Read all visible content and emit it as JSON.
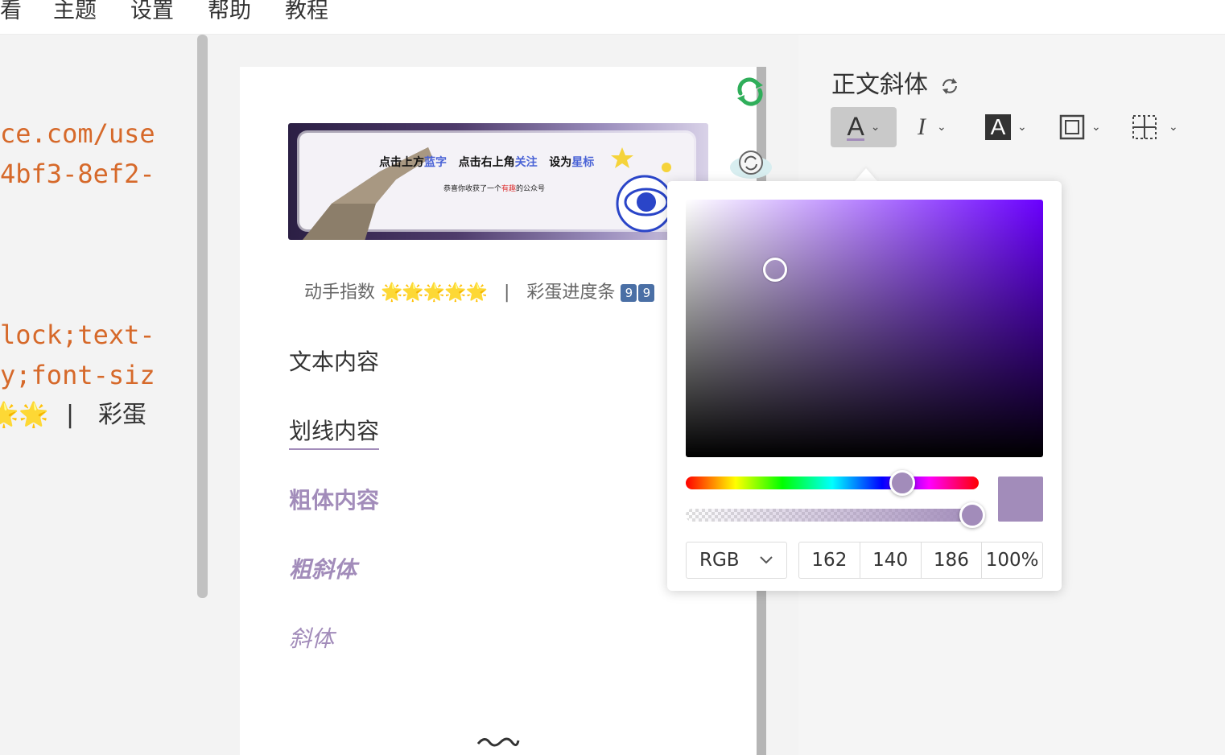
{
  "menubar": {
    "items": [
      "看",
      "主题",
      "设置",
      "帮助",
      "教程"
    ]
  },
  "editor": {
    "lines": [
      "ce.com/use",
      "4bf3-8ef2-",
      "lock;text-",
      "y;font-siz"
    ],
    "last_line_stars": "🌟🌟",
    "last_line_sep": "|",
    "last_line_text": "彩蛋"
  },
  "banner": {
    "part1": "点击上方",
    "part1_blue": "蓝字",
    "part2": "点击右上角",
    "part2_blue": "关注",
    "part3": "设为",
    "part3_blue": "星标",
    "sub_pre": "恭喜你收获了一个",
    "sub_red": "有趣",
    "sub_post": "的公众号"
  },
  "info": {
    "label1": "动手指数",
    "stars": "🌟🌟🌟🌟🌟",
    "sep": "|",
    "label2": "彩蛋进度条",
    "badge1": "9",
    "badge2": "9"
  },
  "preview": {
    "text": "文本内容",
    "underline": "划线内容",
    "bold": "粗体内容",
    "bold_italic": "粗斜体",
    "italic": "斜体"
  },
  "panel": {
    "title": "正文斜体"
  },
  "toolbar": {
    "font_color_letter": "A",
    "italic_letter": "I",
    "bg_letter": "A"
  },
  "colors": {
    "selected": "#a28cba",
    "code": "#d6692a",
    "hue_base": "#6a00ff"
  },
  "picker": {
    "mode": "RGB",
    "r": "162",
    "g": "140",
    "b": "186",
    "alpha": "100%",
    "alpha_fraction": 1.0,
    "hue_fraction": 0.74
  }
}
